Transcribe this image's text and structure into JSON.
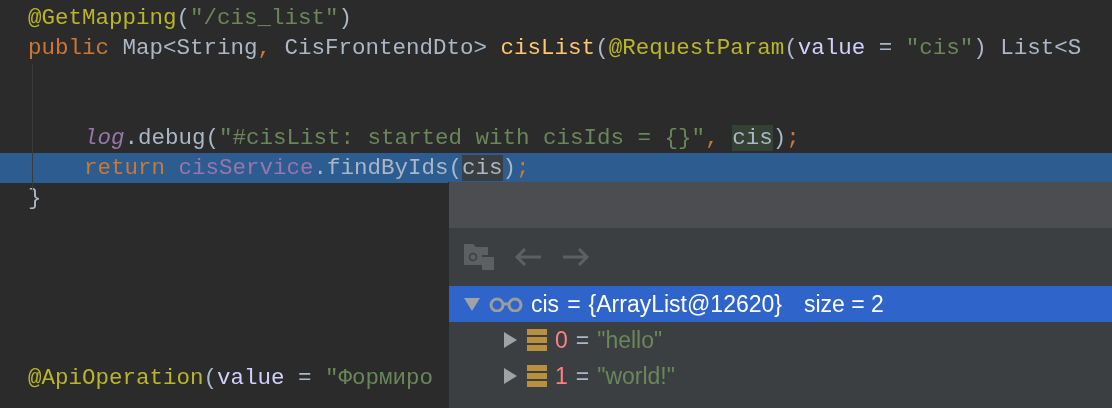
{
  "editor": {
    "lines": [
      {
        "highlighted": false,
        "indented": false,
        "tokens": [
          {
            "kind": "annotation",
            "text": "@GetMapping"
          },
          {
            "kind": "plain",
            "text": "("
          },
          {
            "kind": "string",
            "text": "\"/cis_list\""
          },
          {
            "kind": "plain",
            "text": ")"
          }
        ]
      },
      {
        "highlighted": false,
        "indented": false,
        "tokens": [
          {
            "kind": "keyword",
            "text": "public "
          },
          {
            "kind": "plain",
            "text": "Map<String"
          },
          {
            "kind": "keyword",
            "text": ", "
          },
          {
            "kind": "plain",
            "text": "CisFrontendDto> "
          },
          {
            "kind": "method",
            "text": "cisList"
          },
          {
            "kind": "plain",
            "text": "("
          },
          {
            "kind": "annotation",
            "text": "@RequestParam"
          },
          {
            "kind": "plain",
            "text": "("
          },
          {
            "kind": "param",
            "text": "value"
          },
          {
            "kind": "plain",
            "text": " = "
          },
          {
            "kind": "string",
            "text": "\"cis\""
          },
          {
            "kind": "plain",
            "text": ") List<S"
          }
        ]
      },
      {
        "highlighted": false
      },
      {
        "highlighted": false
      },
      {
        "highlighted": false,
        "indented": true,
        "tokens": [
          {
            "kind": "static_field",
            "text": "log"
          },
          {
            "kind": "plain",
            "text": ".debug("
          },
          {
            "kind": "string",
            "text": "\"#cisList: started with cisIds = {}\""
          },
          {
            "kind": "keyword",
            "text": ", "
          },
          {
            "kind": "usage_write",
            "text": "cis"
          },
          {
            "kind": "plain",
            "text": ")"
          },
          {
            "kind": "keyword",
            "text": ";"
          }
        ]
      },
      {
        "highlighted": true,
        "indented": true,
        "tokens": [
          {
            "kind": "keyword",
            "text": "return "
          },
          {
            "kind": "field",
            "text": "cisService"
          },
          {
            "kind": "plain",
            "text": ".findByIds("
          },
          {
            "kind": "usage_read",
            "text": "cis"
          },
          {
            "kind": "plain",
            "text": ")"
          },
          {
            "kind": "keyword",
            "text": ";"
          }
        ]
      },
      {
        "highlighted": false,
        "indented": false,
        "tokens": [
          {
            "kind": "plain",
            "text": "}"
          }
        ]
      },
      {
        "highlighted": false
      },
      {
        "highlighted": false
      },
      {
        "highlighted": false
      },
      {
        "highlighted": false
      },
      {
        "highlighted": false
      },
      {
        "highlighted": false,
        "indented": false,
        "tokens": [
          {
            "kind": "annotation",
            "text": "@ApiOperation"
          },
          {
            "kind": "plain",
            "text": "("
          },
          {
            "kind": "param",
            "text": "value"
          },
          {
            "kind": "plain",
            "text": " = "
          },
          {
            "kind": "string",
            "text": "\"Формиро"
          }
        ]
      }
    ]
  },
  "debug_popup": {
    "toolbar": [
      {
        "kind": "folder",
        "disabled": true
      },
      {
        "kind": "back",
        "disabled": true
      },
      {
        "kind": "forward",
        "disabled": true
      }
    ],
    "tree": [
      {
        "kind": "watch",
        "name": "cis",
        "sep": "=",
        "value": "{ArrayList@12620}",
        "extra": "size = 2",
        "selected": true,
        "expanded": true,
        "children": [
          {
            "kind": "element",
            "name": "0",
            "sep": "=",
            "value": "\"hello\"",
            "selected": false,
            "expanded": false
          },
          {
            "kind": "element",
            "name": "1",
            "sep": "=",
            "value": "\"world!\"",
            "selected": false,
            "expanded": false
          }
        ]
      }
    ]
  }
}
